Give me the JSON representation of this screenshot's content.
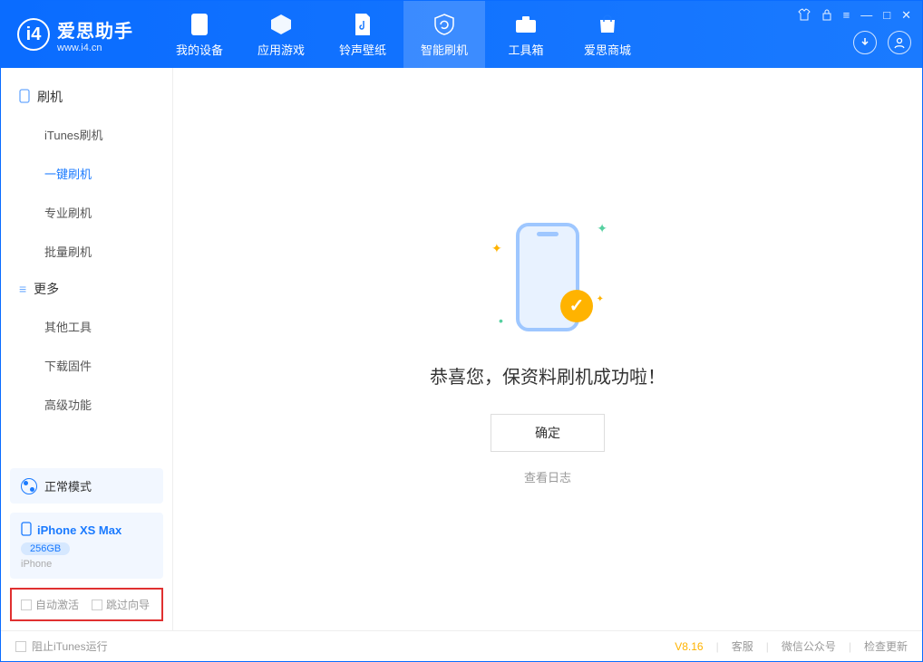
{
  "app": {
    "title": "爱思助手",
    "subtitle": "www.i4.cn"
  },
  "nav": {
    "tabs": [
      {
        "label": "我的设备"
      },
      {
        "label": "应用游戏"
      },
      {
        "label": "铃声壁纸"
      },
      {
        "label": "智能刷机"
      },
      {
        "label": "工具箱"
      },
      {
        "label": "爱思商城"
      }
    ]
  },
  "sidebar": {
    "group_flash": "刷机",
    "items_flash": [
      "iTunes刷机",
      "一键刷机",
      "专业刷机",
      "批量刷机"
    ],
    "group_more": "更多",
    "items_more": [
      "其他工具",
      "下载固件",
      "高级功能"
    ],
    "mode_label": "正常模式",
    "device": {
      "name": "iPhone XS Max",
      "storage": "256GB",
      "type": "iPhone"
    },
    "checkboxes": {
      "auto_activate": "自动激活",
      "skip_guide": "跳过向导"
    }
  },
  "main": {
    "success_text": "恭喜您，保资料刷机成功啦！",
    "ok_label": "确定",
    "log_link": "查看日志"
  },
  "statusbar": {
    "block_itunes": "阻止iTunes运行",
    "version": "V8.16",
    "links": [
      "客服",
      "微信公众号",
      "检查更新"
    ]
  }
}
